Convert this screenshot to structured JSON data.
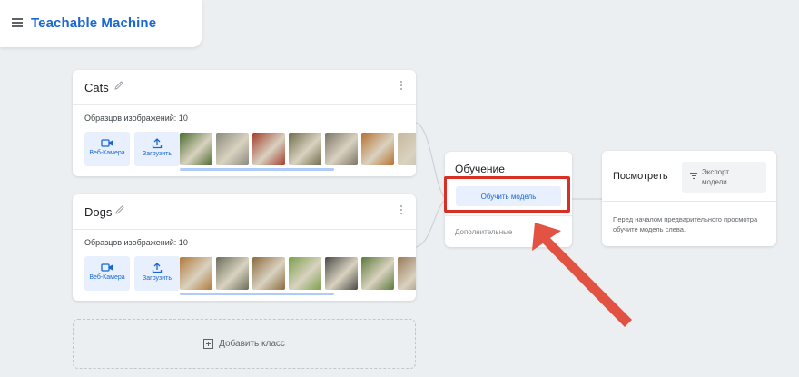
{
  "header": {
    "app_title": "Teachable Machine"
  },
  "classes": [
    {
      "name": "Cats",
      "samples_label": "Образцов изображений: 10",
      "thumb_colors": [
        "#4b6b2e",
        "#8a8a7e",
        "#a33b2a",
        "#6f6a4a",
        "#7a7466",
        "#b6702e",
        "#c7b8a0"
      ]
    },
    {
      "name": "Dogs",
      "samples_label": "Образцов изображений: 10",
      "thumb_colors": [
        "#b07a3a",
        "#6a6d5a",
        "#8c6a3e",
        "#7aa04a",
        "#4a4a45",
        "#5c7a3a",
        "#9a7a5a"
      ]
    }
  ],
  "class_buttons": {
    "webcam": "Веб-Камера",
    "upload": "Загрузить"
  },
  "add_class": {
    "label": "Добавить класс"
  },
  "training": {
    "title": "Обучение",
    "train_button": "Обучить модель",
    "advanced": "Дополнительные"
  },
  "preview": {
    "title": "Посмотреть",
    "export_line1": "Экспорт",
    "export_line2": "модели",
    "hint": "Перед началом предварительного просмотра обучите модель слева."
  },
  "colors": {
    "accent": "#1967d2",
    "annotation": "#d93025",
    "button_bg": "#e8f0fe"
  }
}
